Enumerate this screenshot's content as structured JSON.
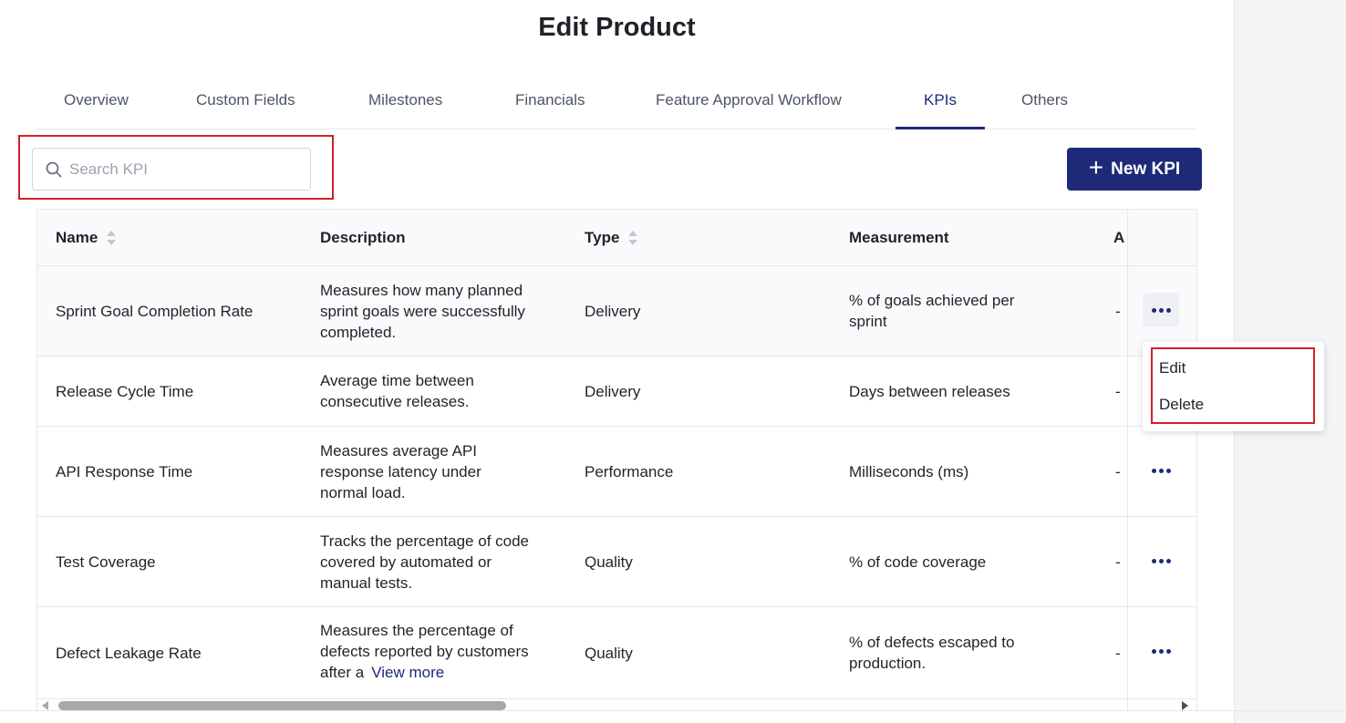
{
  "page": {
    "title": "Edit Product"
  },
  "tabs": [
    {
      "label": "Overview"
    },
    {
      "label": "Custom Fields"
    },
    {
      "label": "Milestones"
    },
    {
      "label": "Financials"
    },
    {
      "label": "Feature Approval Workflow"
    },
    {
      "label": "KPIs",
      "active": true
    },
    {
      "label": "Others"
    }
  ],
  "search": {
    "placeholder": "Search KPI",
    "value": ""
  },
  "toolbar": {
    "new_label": "New KPI"
  },
  "table": {
    "headers": {
      "name": "Name",
      "description": "Description",
      "type": "Type",
      "measurement": "Measurement",
      "truncated": "A"
    },
    "rows": [
      {
        "name": "Sprint Goal Completion Rate",
        "description": "Measures how many planned sprint goals were successfully completed.",
        "type": "Delivery",
        "measurement": "% of goals achieved per sprint",
        "extra": "-"
      },
      {
        "name": "Release Cycle Time",
        "description": "Average time between consecutive releases.",
        "type": "Delivery",
        "measurement": "Days between releases",
        "extra": "-"
      },
      {
        "name": "API Response Time",
        "description": "Measures average API response latency under normal load.",
        "type": "Performance",
        "measurement": "Milliseconds (ms)",
        "extra": "-"
      },
      {
        "name": "Test Coverage",
        "description": "Tracks the percentage of code covered by automated or manual tests.",
        "type": "Quality",
        "measurement": "% of code coverage",
        "extra": "-"
      },
      {
        "name": "Defect Leakage Rate",
        "description": "Measures the percentage of defects reported by customers after a",
        "type": "Quality",
        "measurement": "% of defects escaped to production.",
        "extra": "-",
        "view_more": "View more"
      }
    ]
  },
  "row_menu": {
    "items": [
      {
        "label": "Edit"
      },
      {
        "label": "Delete"
      }
    ]
  },
  "colors": {
    "primary": "#1e2a78",
    "highlight": "#d32027"
  }
}
